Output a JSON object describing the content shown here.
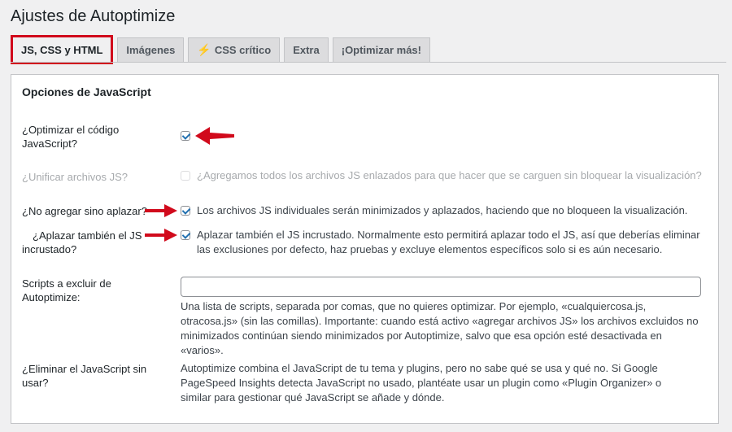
{
  "page": {
    "title": "Ajustes de Autoptimize"
  },
  "tabs": [
    {
      "label": "JS, CSS y HTML",
      "active": true
    },
    {
      "label": "Imágenes",
      "active": false
    },
    {
      "label": "CSS crítico",
      "icon": "lightning-icon",
      "active": false
    },
    {
      "label": "Extra",
      "active": false
    },
    {
      "label": "¡Optimizar más!",
      "active": false
    }
  ],
  "section": {
    "title": "Opciones de JavaScript"
  },
  "options": {
    "optimize_js": {
      "label": "¿Optimizar el código JavaScript?",
      "checked": true
    },
    "aggregate_js": {
      "label": "¿Unificar archivos JS?",
      "checked": false,
      "disabled": true,
      "description": "¿Agregamos todos los archivos JS enlazados para que hacer que se carguen sin bloquear la visualización?"
    },
    "defer_js": {
      "label": "¿No agregar sino aplazar?",
      "checked": true,
      "description": "Los archivos JS individuales serán minimizados y aplazados, haciendo que no bloqueen la visualización."
    },
    "defer_inline": {
      "label": "¿Aplazar también el JS incrustado?",
      "checked": true,
      "description": "Aplazar también el JS incrustado. Normalmente esto permitirá aplazar todo el JS, así que deberías eliminar las exclusiones por defecto, haz pruebas y excluye elementos específicos solo si es aún necesario."
    },
    "exclude_scripts": {
      "label": "Scripts a excluir de Autoptimize:",
      "value": "",
      "description": "Una lista de scripts, separada por comas, que no quieres optimizar. Por ejemplo, «cualquiercosa.js, otracosa.js» (sin las comillas). Importante: cuando está activo «agregar archivos JS» los archivos excluidos no minimizados continúan siendo minimizados por Autoptimize, salvo que esa opción esté desactivada en «varios»."
    },
    "unused_js": {
      "label": "¿Eliminar el JavaScript sin usar?",
      "description": "Autoptimize combina el JavaScript de tu tema y plugins, pero no sabe qué se usa y qué no. Si Google PageSpeed Insights detecta JavaScript no usado, plantéate usar un plugin como «Plugin Organizer» o similar para gestionar qué JavaScript se añade y dónde."
    }
  },
  "colors": {
    "highlight": "#d10a1c",
    "accent": "#2271b1"
  }
}
